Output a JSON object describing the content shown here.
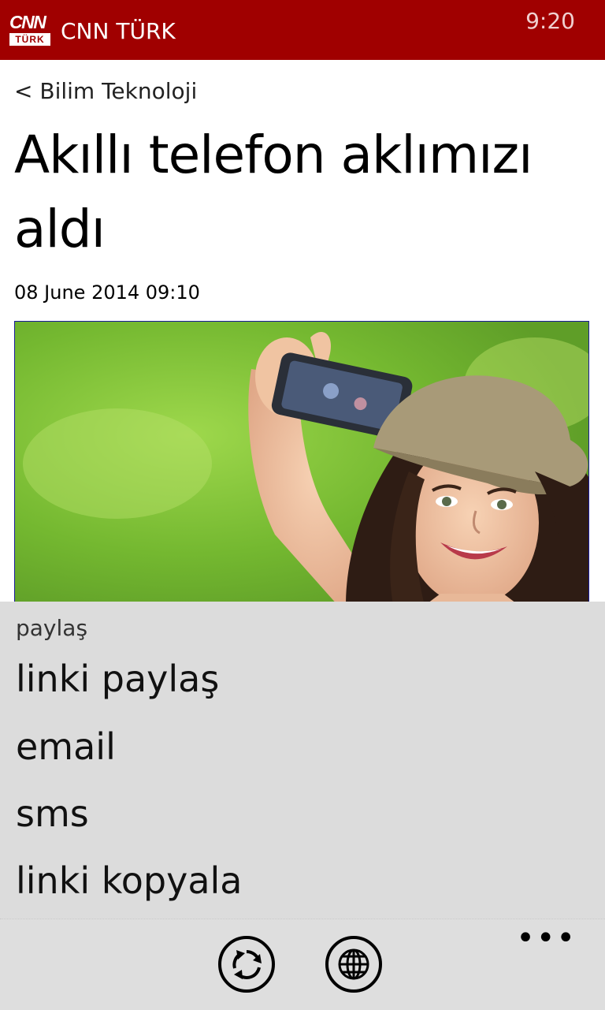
{
  "header": {
    "logo_top": "CNN",
    "logo_bottom": "TÜRK",
    "app_title": "CNN TÜRK",
    "clock": "9:20",
    "background_color": "#a00000"
  },
  "article": {
    "breadcrumb": "< Bilim Teknoloji",
    "title": "Akıllı telefon aklımızı aldı",
    "date": "08 June 2014 09:10"
  },
  "share_menu": {
    "heading": "paylaş",
    "items": [
      {
        "label": "linki paylaş"
      },
      {
        "label": "email"
      },
      {
        "label": "sms"
      },
      {
        "label": "linki kopyala"
      }
    ]
  },
  "app_bar": {
    "buttons": [
      {
        "icon": "refresh-icon"
      },
      {
        "icon": "globe-icon"
      }
    ],
    "more": "•••"
  }
}
